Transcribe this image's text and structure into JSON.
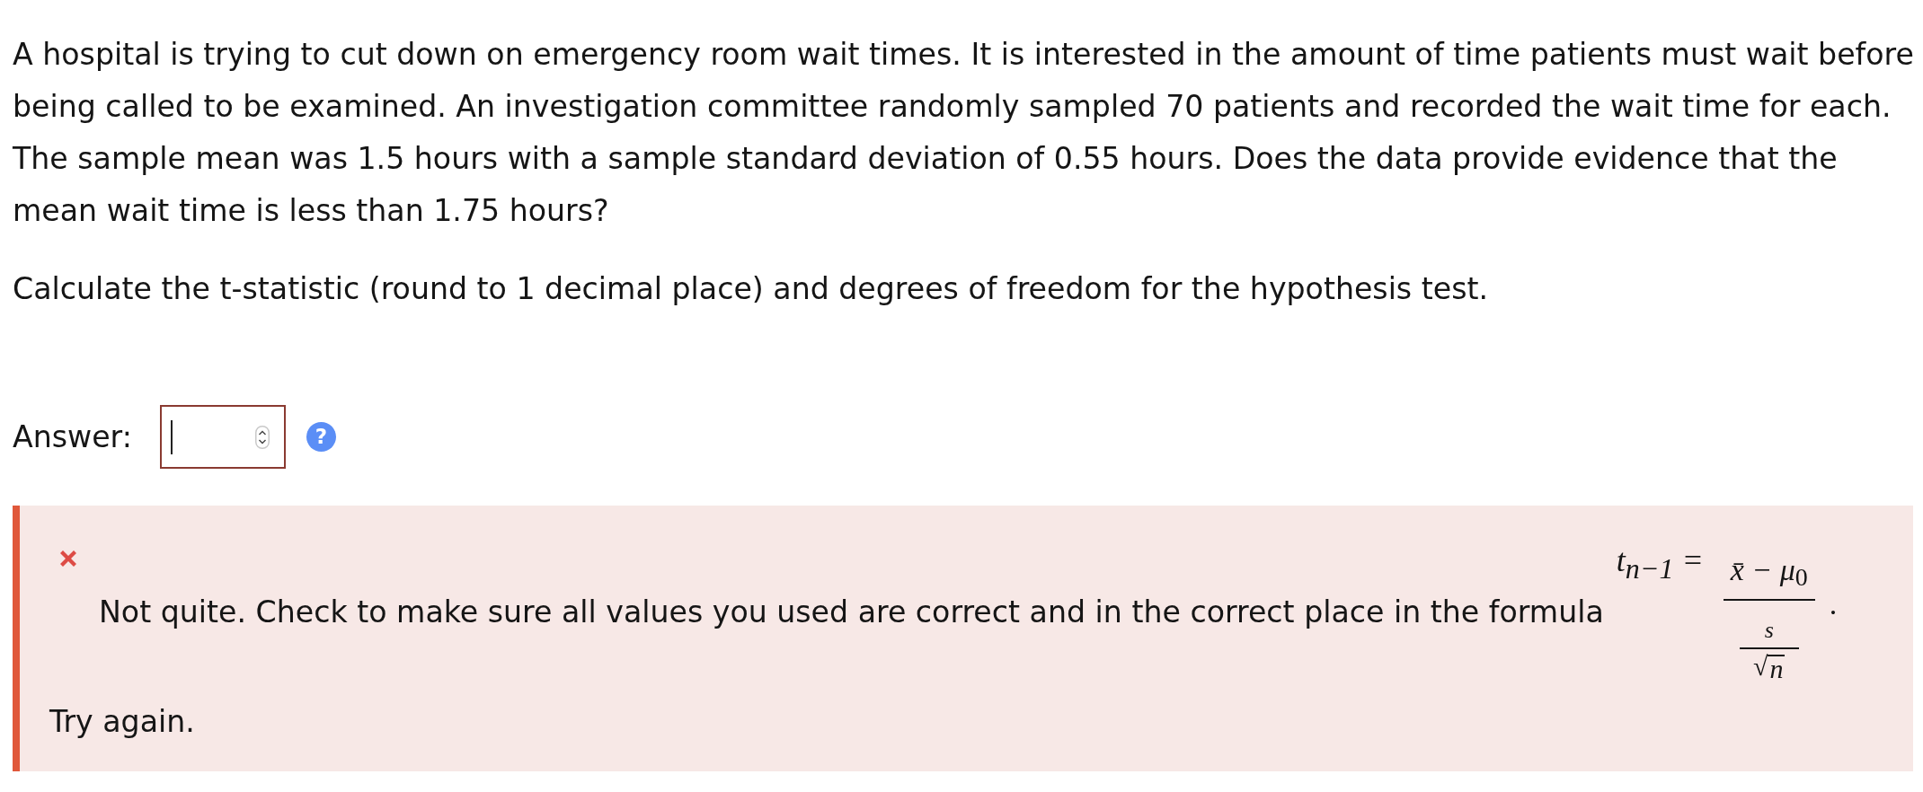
{
  "question": {
    "paragraphs": [
      "A hospital is trying to cut down on emergency room wait times. It is interested in the amount of time patients must wait before being called to be examined. An investigation committee randomly sampled 70 patients and recorded the wait time for each. The sample mean was 1.5 hours with a sample standard deviation of 0.55 hours. Does the data provide evidence that the mean wait time is less than 1.75 hours?",
      "Calculate the t-statistic (round to 1 decimal place) and degrees of freedom for the hypothesis test."
    ]
  },
  "answer": {
    "label": "Answer:",
    "incorrect": true,
    "focused": true,
    "help": "?"
  },
  "feedback": {
    "kind": "incorrect",
    "message": "Not quite. Check to make sure all values you used are correct and in the correct place in the formula",
    "formula": {
      "lhs": "t$_{n−1}$ =",
      "numerator": "x̄ − μ$_{0}$",
      "denominator": {
        "numerator": "s",
        "radical": "√",
        "radicand": "n"
      },
      "trailing": "."
    },
    "retry": "Try again."
  }
}
